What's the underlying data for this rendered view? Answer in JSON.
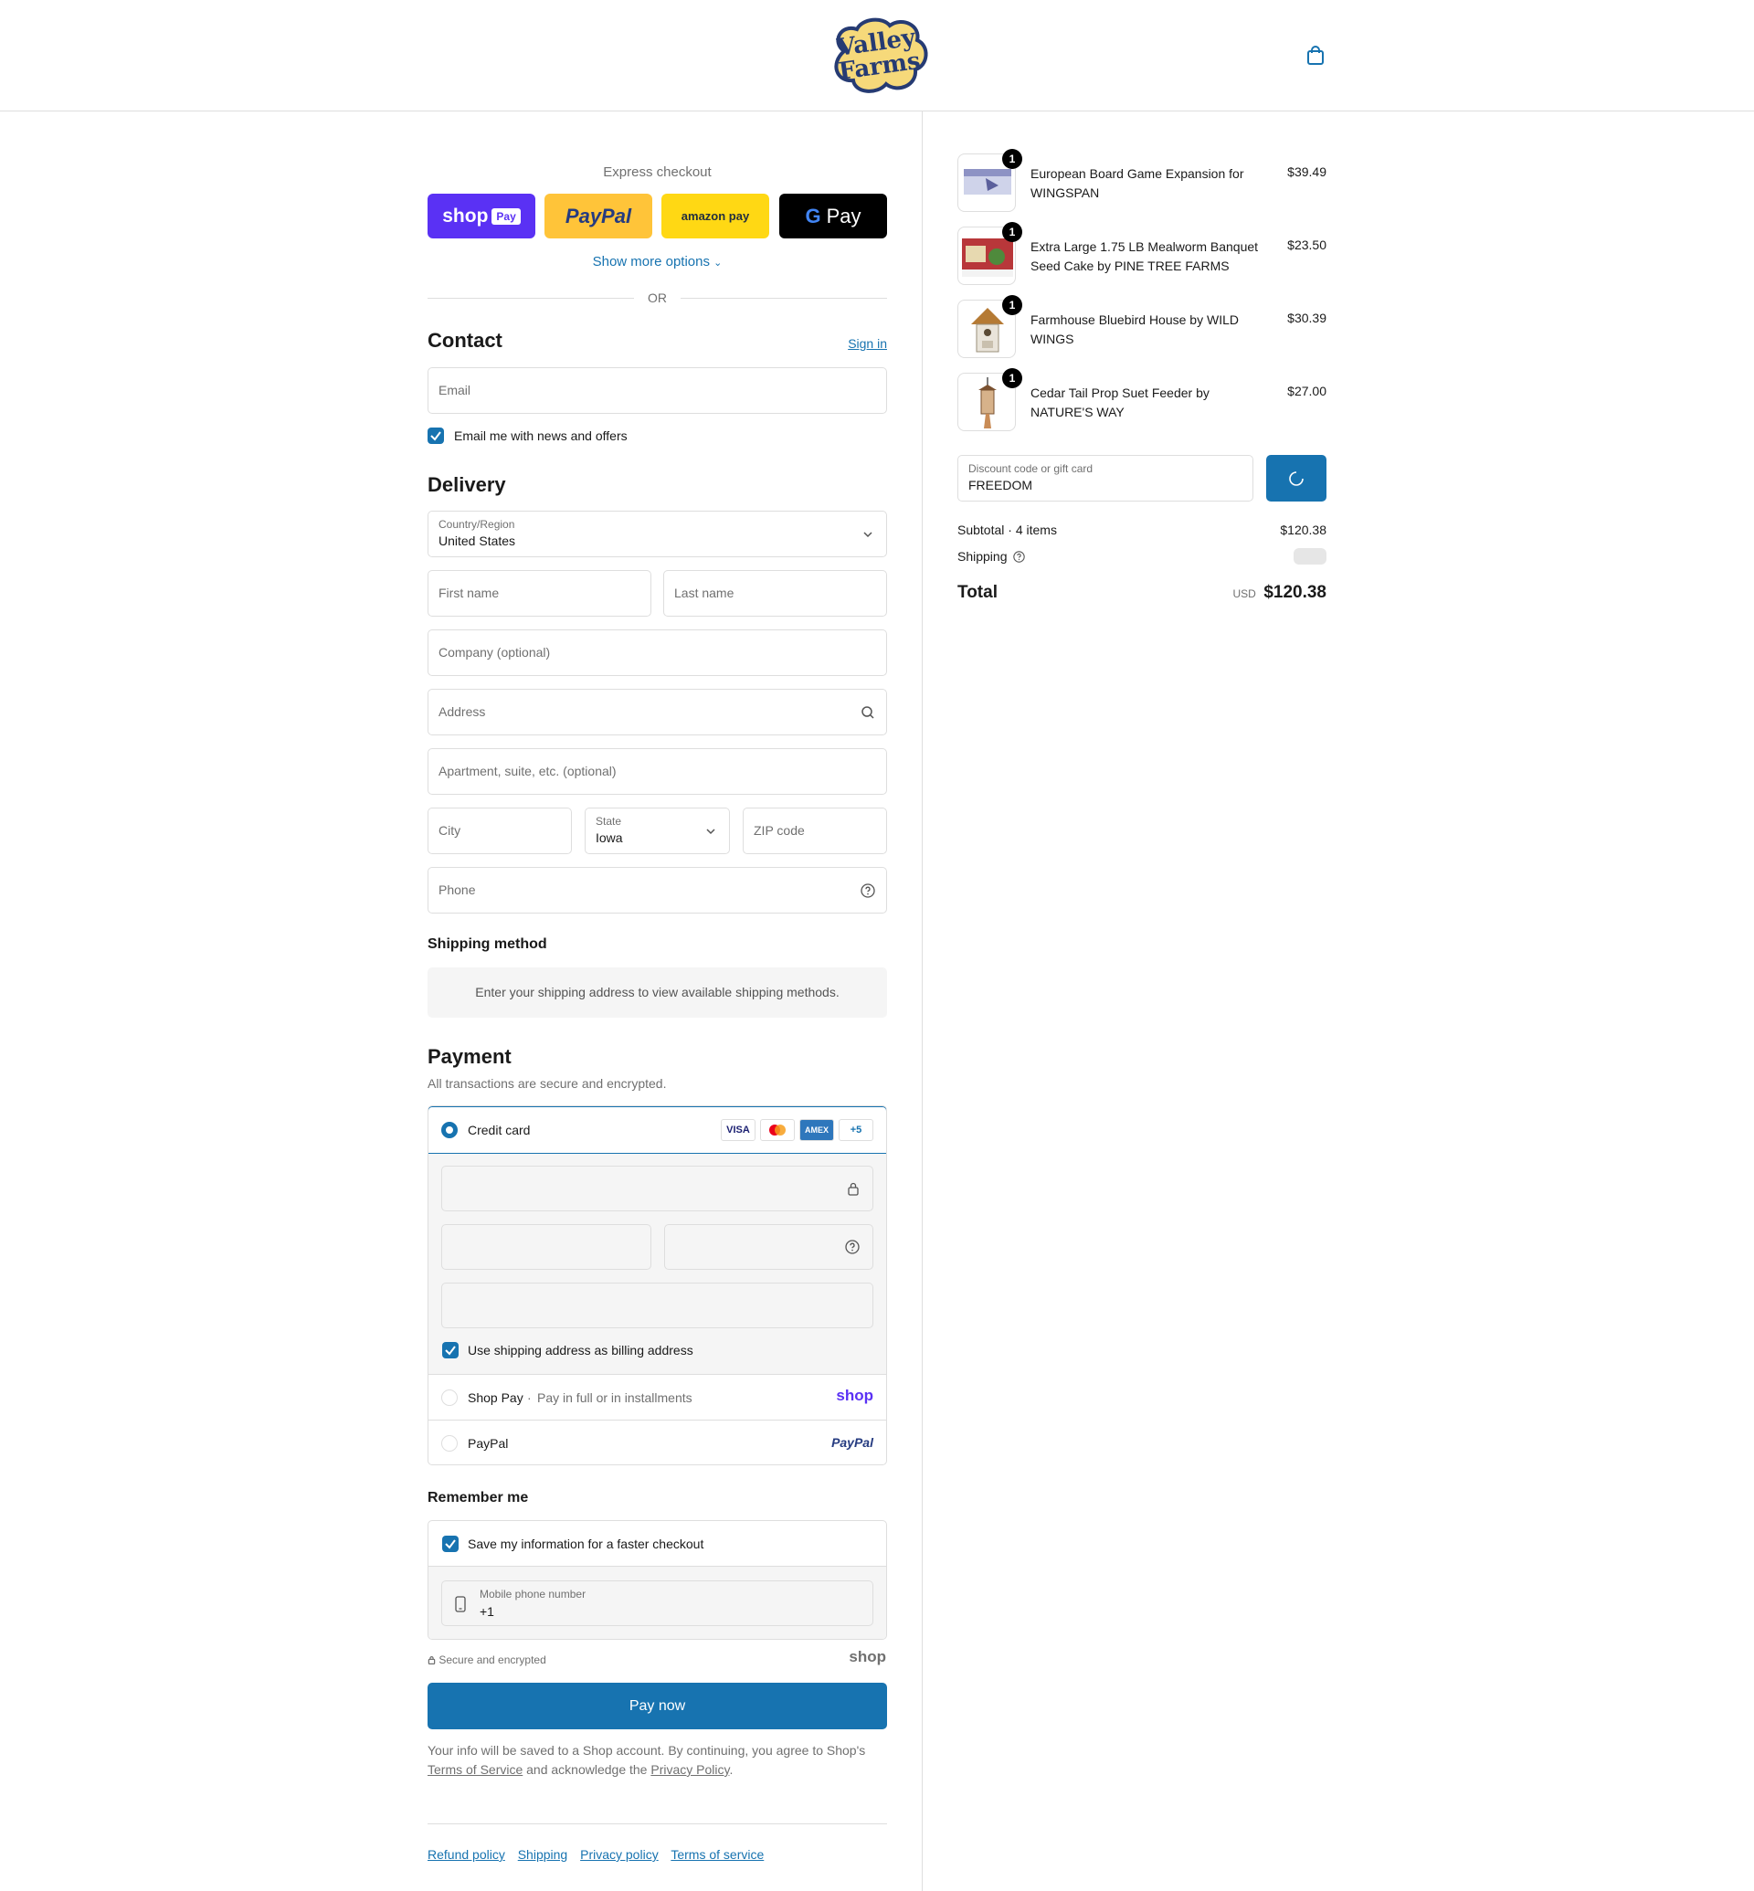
{
  "brand": {
    "logo_line1": "Valley",
    "logo_line2": "Farms",
    "accent": "#1773b0"
  },
  "express": {
    "label": "Express checkout",
    "shop_pay": "shop",
    "shop_pay_badge": "Pay",
    "paypal": "PayPal",
    "amazon_pay": "amazon pay",
    "google_pay": "Pay",
    "show_more": "Show more options",
    "or": "OR"
  },
  "contact": {
    "heading": "Contact",
    "sign_in": "Sign in",
    "email_placeholder": "Email",
    "newsletter_label": "Email me with news and offers"
  },
  "delivery": {
    "heading": "Delivery",
    "country_label": "Country/Region",
    "country_value": "United States",
    "first_name": "First name",
    "last_name": "Last name",
    "company": "Company (optional)",
    "address": "Address",
    "apartment": "Apartment, suite, etc. (optional)",
    "city": "City",
    "state_label": "State",
    "state_value": "Iowa",
    "zip": "ZIP code",
    "phone": "Phone"
  },
  "shipping_method": {
    "heading": "Shipping method",
    "note": "Enter your shipping address to view available shipping methods."
  },
  "payment": {
    "heading": "Payment",
    "subtitle": "All transactions are secure and encrypted.",
    "credit_card": "Credit card",
    "cards": [
      "VISA",
      "MC",
      "AMEX",
      "+5"
    ],
    "billing_label": "Use shipping address as billing address",
    "shop_pay": "Shop Pay",
    "shop_pay_sub": "Pay in full or in installments",
    "shop_logo": "shop",
    "paypal": "PayPal",
    "paypal_logo": "PayPal"
  },
  "remember": {
    "heading": "Remember me",
    "save_label": "Save my information for a faster checkout",
    "mobile_label": "Mobile phone number",
    "mobile_value": "+1",
    "secure": "Secure and encrypted",
    "shop_logo": "shop"
  },
  "pay_now": "Pay now",
  "legal": {
    "text1": "Your info will be saved to a Shop account. By continuing, you agree to Shop's",
    "terms": "Terms of Service",
    "text2": "and acknowledge the",
    "privacy": "Privacy Policy",
    "end": "."
  },
  "footer": {
    "links": [
      "Refund policy",
      "Shipping",
      "Privacy policy",
      "Terms of service"
    ]
  },
  "order": {
    "items": [
      {
        "name": "European Board Game Expansion for WINGSPAN",
        "price": "$39.49",
        "qty": "1"
      },
      {
        "name": "Extra Large 1.75 LB Mealworm Banquet Seed Cake by PINE TREE FARMS",
        "price": "$23.50",
        "qty": "1"
      },
      {
        "name": "Farmhouse Bluebird House by WILD WINGS",
        "price": "$30.39",
        "qty": "1"
      },
      {
        "name": "Cedar Tail Prop Suet Feeder by NATURE'S WAY",
        "price": "$27.00",
        "qty": "1"
      }
    ],
    "discount_label": "Discount code or gift card",
    "discount_value": "FREEDOM",
    "subtotal_label": "Subtotal · 4 items",
    "subtotal_value": "$120.38",
    "shipping_label": "Shipping",
    "total_label": "Total",
    "currency": "USD",
    "total_value": "$120.38"
  }
}
